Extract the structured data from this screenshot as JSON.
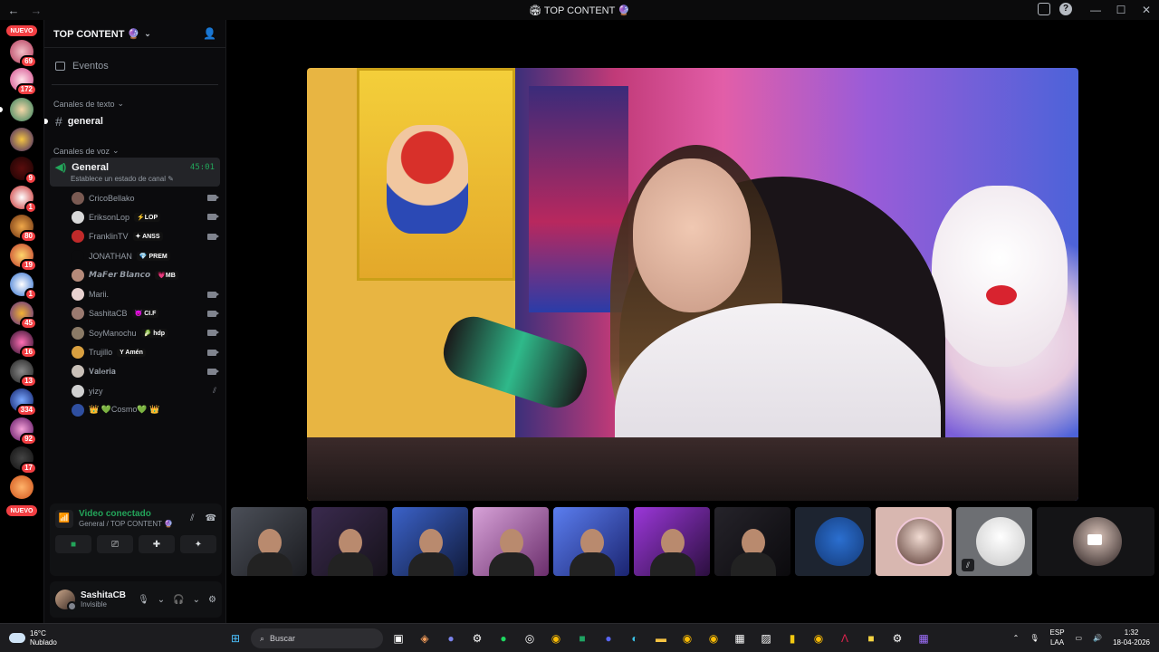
{
  "window": {
    "title": "TOP CONTENT",
    "back": "←",
    "forward": "→"
  },
  "rail": {
    "new_label_top": "NUEVO",
    "new_label_bottom": "NUEVO",
    "badges": [
      "69",
      "172",
      "",
      "",
      "9",
      "1",
      "80",
      "19",
      "1",
      "45",
      "16",
      "13",
      "334",
      "92",
      "17",
      ""
    ]
  },
  "guild": {
    "name": "TOP CONTENT",
    "events_label": "Eventos",
    "text_category": "Canales de texto",
    "text_channel": "general",
    "voice_category": "Canales de voz",
    "voice_channel": "General",
    "voice_time": "45:01",
    "voice_status": "Establece un estado de canal"
  },
  "members": [
    {
      "name": "CricoBellako",
      "tag": "",
      "tag_color": "",
      "icon": "camera",
      "avatar": "#7a5a52"
    },
    {
      "name": "EriksonLop",
      "tag": "⚡LOP",
      "tag_color": "#111",
      "icon": "camera",
      "avatar": "#d8d8d8"
    },
    {
      "name": "FranklinTV",
      "tag": "✦ ANSS",
      "tag_color": "#111",
      "icon": "camera",
      "avatar": "#c12a2a"
    },
    {
      "name": "JONATHAN",
      "tag": "💎 PREM",
      "tag_color": "#111",
      "icon": "",
      "avatar": "#0b0b0d"
    },
    {
      "name": "𝙈𝙖𝙁𝙚𝙧 𝘽𝙡𝙖𝙣𝙘𝙤",
      "tag": "💗MB",
      "tag_color": "#111",
      "icon": "",
      "avatar": "#b58a7a"
    },
    {
      "name": "Marii.",
      "tag": "",
      "tag_color": "",
      "icon": "camera",
      "avatar": "#e8d2d0"
    },
    {
      "name": "SashitaCB",
      "tag": "😈 CI.F",
      "tag_color": "#111",
      "icon": "camera",
      "avatar": "#9a7a70"
    },
    {
      "name": "SoyManochu",
      "tag": "🥬 hdp",
      "tag_color": "#111",
      "icon": "camera",
      "avatar": "#8a7a66"
    },
    {
      "name": "Trujillo",
      "tag": "Y Amén",
      "tag_color": "#111",
      "icon": "camera",
      "avatar": "#d9a040"
    },
    {
      "name": "𝐕𝐚𝐥𝐞𝐫𝐢𝐚",
      "tag": "",
      "tag_color": "",
      "icon": "camera",
      "avatar": "#c9c0b8"
    },
    {
      "name": "yizy",
      "tag": "",
      "tag_color": "",
      "icon": "mute",
      "avatar": "#d0d0d0"
    },
    {
      "name": "👑 💚Cosmo💚 👑",
      "tag": "",
      "tag_color": "",
      "icon": "",
      "avatar": "#2f4fa0"
    }
  ],
  "voice_panel": {
    "title": "Video conectado",
    "subtitle": "General / TOP CONTENT"
  },
  "user": {
    "name": "SashitaCB",
    "status": "Invisible"
  },
  "taskbar": {
    "temp": "16°C",
    "weather": "Nublado",
    "search_placeholder": "Buscar",
    "lang_1": "ESP",
    "lang_2": "LAA",
    "time": "1:32",
    "date": "18-04-2026"
  },
  "colors": {
    "accent_green": "#23a55a",
    "badge_red": "#f23f43"
  }
}
